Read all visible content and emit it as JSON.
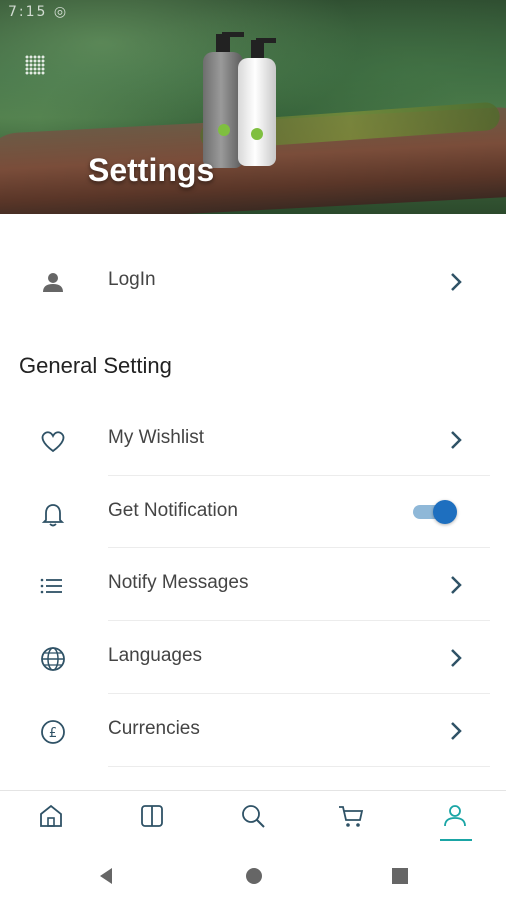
{
  "status_bar": {
    "text": "7:15 ◎"
  },
  "header": {
    "title": "Settings"
  },
  "login": {
    "label": "LogIn"
  },
  "general": {
    "title": "General Setting",
    "items": [
      {
        "label": "My Wishlist",
        "icon": "heart-icon",
        "control": "chevron"
      },
      {
        "label": "Get Notification",
        "icon": "bell-icon",
        "control": "toggle",
        "toggle_on": true
      },
      {
        "label": "Notify Messages",
        "icon": "list-icon",
        "control": "chevron"
      },
      {
        "label": "Languages",
        "icon": "globe-icon",
        "control": "chevron"
      },
      {
        "label": "Currencies",
        "icon": "pound-icon",
        "control": "chevron"
      }
    ]
  },
  "tabbar": {
    "tabs": [
      {
        "icon": "home-icon"
      },
      {
        "icon": "categories-icon"
      },
      {
        "icon": "search-icon"
      },
      {
        "icon": "cart-icon"
      },
      {
        "icon": "user-icon",
        "active": true
      }
    ],
    "active_color": "#1aa5a5"
  },
  "colors": {
    "icon": "#2f5266",
    "toggle_accent": "#1e6fbf"
  }
}
